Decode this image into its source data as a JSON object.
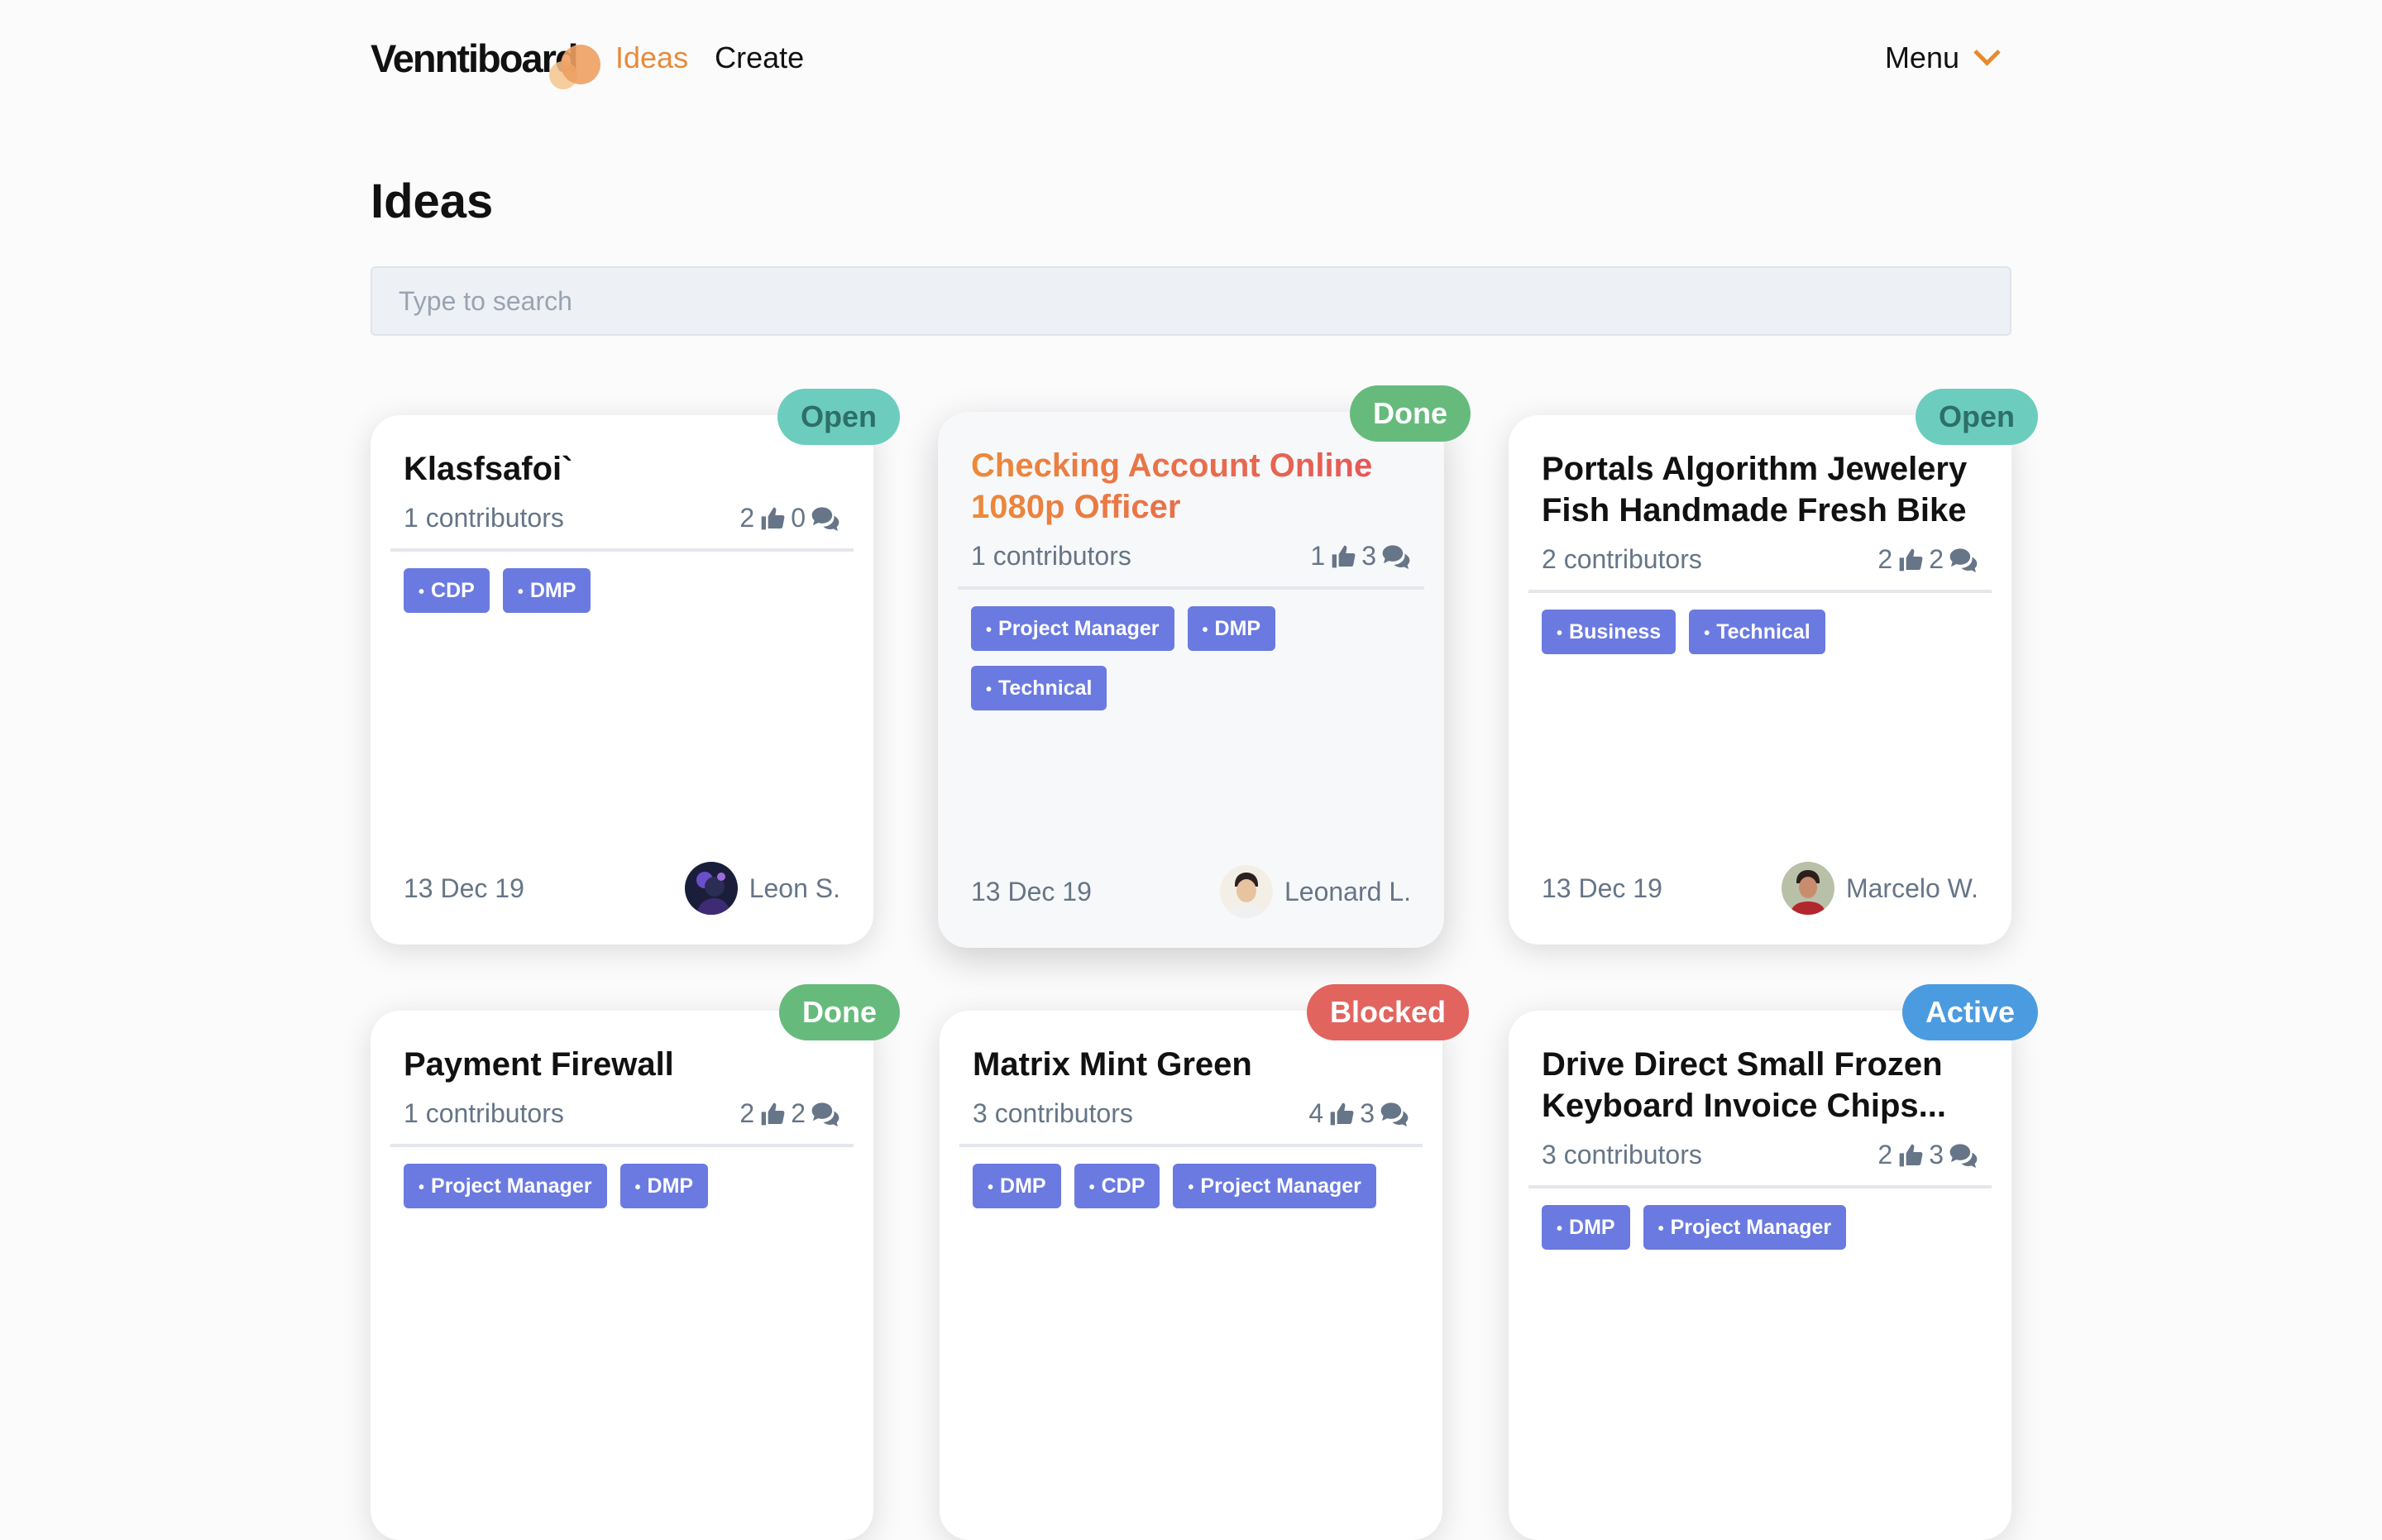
{
  "header": {
    "logo": "Venntiboard",
    "nav": [
      {
        "label": "Ideas",
        "active": true
      },
      {
        "label": "Create",
        "active": false
      }
    ],
    "menu_label": "Menu"
  },
  "page_title": "Ideas",
  "search": {
    "placeholder": "Type to search",
    "value": ""
  },
  "cards": [
    {
      "title": "Klasfsafoi`",
      "status": "Open",
      "contributors": "1 contributors",
      "likes": "2",
      "comments": "0",
      "tags": [
        "CDP",
        "DMP"
      ],
      "date": "13 Dec 19",
      "author": "Leon S."
    },
    {
      "title": "Checking Account Online 1080p Officer",
      "status": "Done",
      "contributors": "1 contributors",
      "likes": "1",
      "comments": "3",
      "tags": [
        "Project Manager",
        "DMP",
        "Technical"
      ],
      "date": "13 Dec 19",
      "author": "Leonard L."
    },
    {
      "title": "Portals Algorithm Jewelery Fish Handmade Fresh Bike",
      "status": "Open",
      "contributors": "2 contributors",
      "likes": "2",
      "comments": "2",
      "tags": [
        "Business",
        "Technical"
      ],
      "date": "13 Dec 19",
      "author": "Marcelo W."
    },
    {
      "title": "Payment Firewall",
      "status": "Done",
      "contributors": "1 contributors",
      "likes": "2",
      "comments": "2",
      "tags": [
        "Project Manager",
        "DMP"
      ]
    },
    {
      "title": "Matrix Mint Green",
      "status": "Blocked",
      "contributors": "3 contributors",
      "likes": "4",
      "comments": "3",
      "tags": [
        "DMP",
        "CDP",
        "Project Manager"
      ]
    },
    {
      "title": "Drive Direct Small Frozen Keyboard Invoice Chips...",
      "status": "Active",
      "contributors": "3 contributors",
      "likes": "2",
      "comments": "3",
      "tags": [
        "DMP",
        "Project Manager"
      ]
    }
  ],
  "colors": {
    "accent": "#e78b3c",
    "tag": "#6b7ae0",
    "status_open": "#6ccdbf",
    "status_done": "#66bb7c",
    "status_blocked": "#e2645f",
    "status_active": "#4b9be0"
  }
}
